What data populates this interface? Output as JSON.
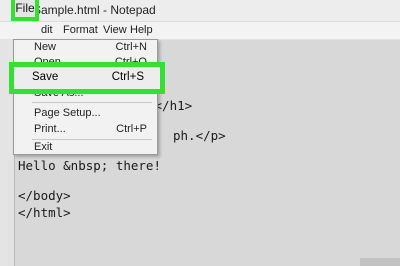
{
  "window": {
    "title": "Sample.html - Notepad"
  },
  "menubar": {
    "items": [
      "File",
      "Edit",
      "Format",
      "View",
      "Help"
    ],
    "visible_fragments": {
      "edit": "dit"
    }
  },
  "file_menu": {
    "items": [
      {
        "label": "New",
        "shortcut": "Ctrl+N"
      },
      {
        "label": "Open...",
        "shortcut": "Ctrl+O"
      },
      {
        "label": "Save",
        "shortcut": "Ctrl+S"
      },
      {
        "label": "Save As...",
        "shortcut": ""
      },
      {
        "label": "Page Setup...",
        "shortcut": ""
      },
      {
        "label": "Print...",
        "shortcut": "Ctrl+P"
      },
      {
        "label": "Exit",
        "shortcut": ""
      }
    ]
  },
  "editor": {
    "visible_lines": [
      "g</h1>",
      "ph.</p>",
      "Hello &nbsp; there!",
      "",
      "</body>",
      "</html>"
    ]
  },
  "highlight_color": "#35e035"
}
